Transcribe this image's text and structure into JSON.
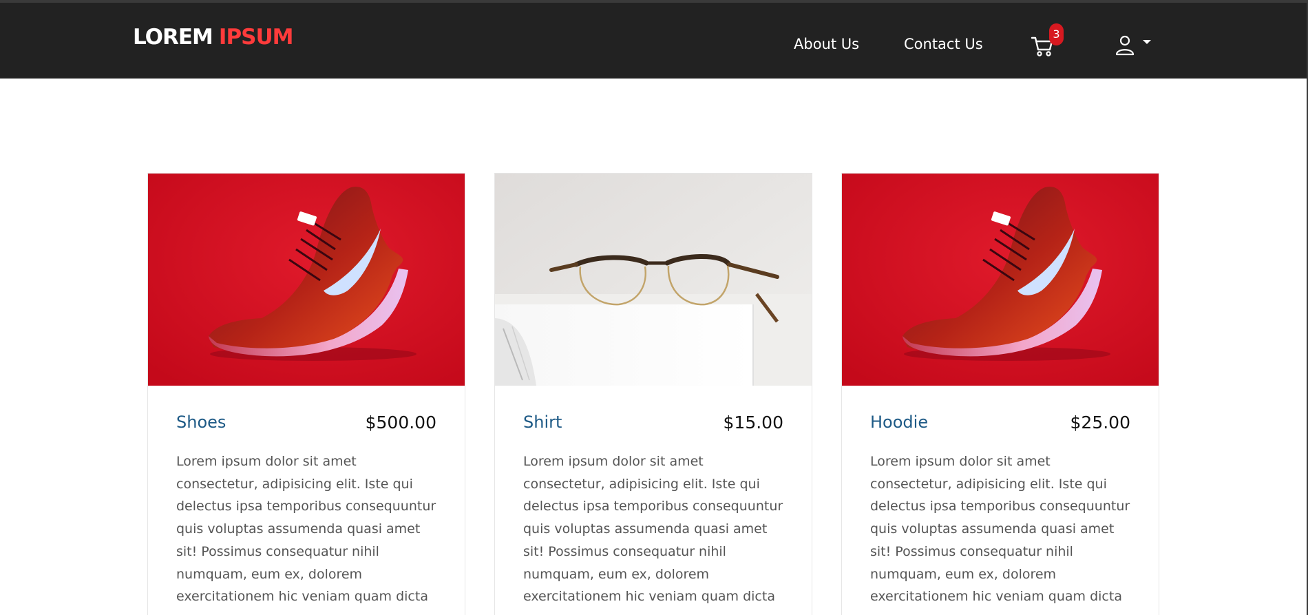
{
  "header": {
    "brand_part1": "LOREM",
    "brand_part2": "IPSUM",
    "nav": {
      "about": "About Us",
      "contact": "Contact Us"
    },
    "cart_count": "3",
    "icons": {
      "cart": "shopping-cart-icon",
      "user": "user-icon",
      "dropdown": "caret-down-icon"
    }
  },
  "colors": {
    "navbar_bg": "#222222",
    "brand_accent": "#ff3b3b",
    "badge": "#d71920",
    "title": "#1e5a86"
  },
  "products": [
    {
      "title": "Shoes",
      "price": "$500.00",
      "description": "Lorem ipsum dolor sit amet consectetur, adipisicing elit. Iste qui delectus ipsa temporibus consequuntur quis voluptas assumenda quasi amet sit! Possimus consequatur nihil numquam, eum ex, dolorem exercitationem hic veniam quam dicta",
      "image": "red-sneaker-photo"
    },
    {
      "title": "Shirt",
      "price": "$15.00",
      "description": "Lorem ipsum dolor sit amet consectetur, adipisicing elit. Iste qui delectus ipsa temporibus consequuntur quis voluptas assumenda quasi amet sit! Possimus consequatur nihil numquam, eum ex, dolorem exercitationem hic veniam quam dicta",
      "image": "eyeglasses-on-book-photo"
    },
    {
      "title": "Hoodie",
      "price": "$25.00",
      "description": "Lorem ipsum dolor sit amet consectetur, adipisicing elit. Iste qui delectus ipsa temporibus consequuntur quis voluptas assumenda quasi amet sit! Possimus consequatur nihil numquam, eum ex, dolorem exercitationem hic veniam quam dicta",
      "image": "red-sneaker-photo"
    }
  ]
}
